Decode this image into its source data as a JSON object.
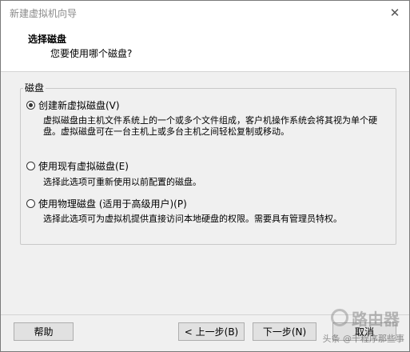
{
  "window": {
    "title": "新建虚拟机向导",
    "close": "✕"
  },
  "header": {
    "title": "选择磁盘",
    "subtitle": "您要使用哪个磁盘?"
  },
  "group": {
    "legend": "磁盘"
  },
  "options": [
    {
      "label": "创建新虚拟磁盘(V)",
      "checked": true,
      "desc": "虚拟磁盘由主机文件系统上的一个或多个文件组成，客户机操作系统会将其视为单个硬盘。虚拟磁盘可在一台主机上或多台主机之间轻松复制或移动。"
    },
    {
      "label": "使用现有虚拟磁盘(E)",
      "checked": false,
      "desc": "选择此选项可重新使用以前配置的磁盘。"
    },
    {
      "label": "使用物理磁盘 (适用于高级用户)(P)",
      "checked": false,
      "desc": "选择此选项可为虚拟机提供直接访问本地硬盘的权限。需要具有管理员特权。"
    }
  ],
  "buttons": {
    "help": "帮助",
    "back": "< 上一步(B)",
    "next": "下一步(N)",
    "cancel": "取消"
  },
  "watermark": {
    "logo": "路由器",
    "text": "头条 @千程序那些事"
  }
}
